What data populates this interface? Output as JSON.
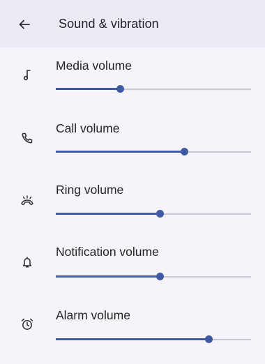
{
  "header": {
    "title": "Sound & vibration",
    "back_icon": "arrow-back-icon"
  },
  "accent_color": "#3f5aa3",
  "sliders": [
    {
      "label": "Media volume",
      "icon": "music-note-icon",
      "value": 0.33
    },
    {
      "label": "Call volume",
      "icon": "phone-icon",
      "value": 0.66
    },
    {
      "label": "Ring volume",
      "icon": "ringing-phone-icon",
      "value": 0.535
    },
    {
      "label": "Notification volume",
      "icon": "bell-icon",
      "value": 0.535
    },
    {
      "label": "Alarm volume",
      "icon": "alarm-clock-icon",
      "value": 0.785
    }
  ]
}
